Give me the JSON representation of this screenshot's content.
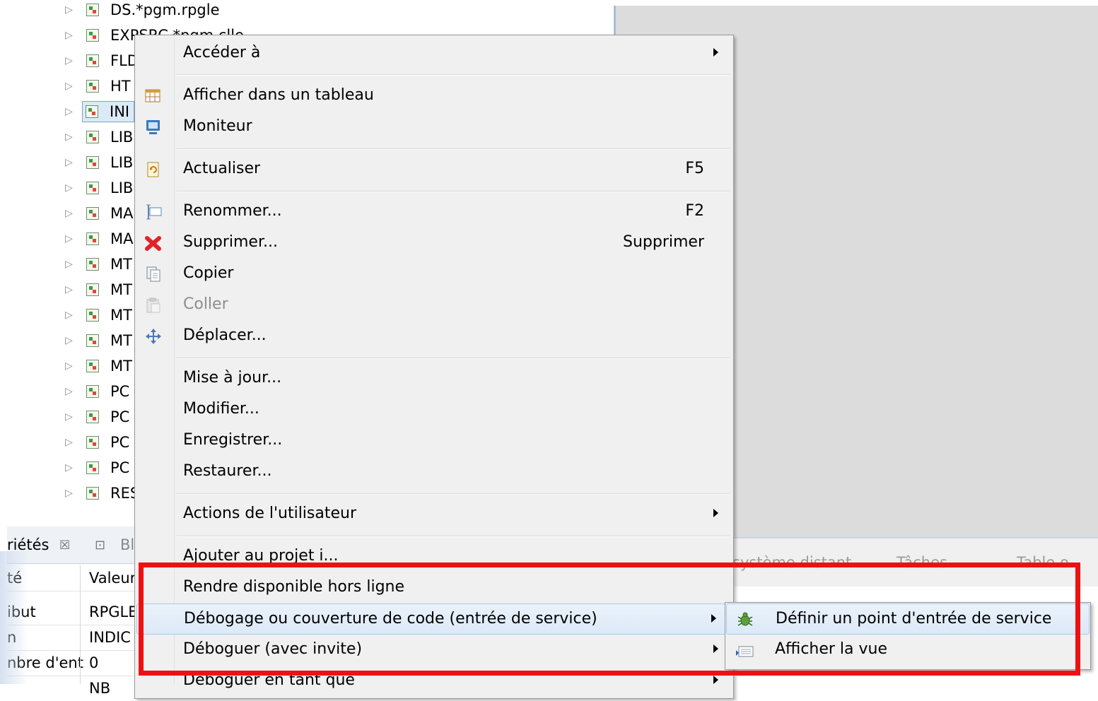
{
  "tree": {
    "rows": [
      {
        "label": "DS.*pgm.rpgle"
      },
      {
        "label": "EXPSRC.*pgm.clle"
      },
      {
        "label": "FLD"
      },
      {
        "label": "HT"
      },
      {
        "label": "INI"
      },
      {
        "label": "LIB"
      },
      {
        "label": "LIB"
      },
      {
        "label": "LIB"
      },
      {
        "label": "MA"
      },
      {
        "label": "MA"
      },
      {
        "label": "MT"
      },
      {
        "label": "MT"
      },
      {
        "label": "MT"
      },
      {
        "label": "MT"
      },
      {
        "label": "MT"
      },
      {
        "label": "PC"
      },
      {
        "label": "PC"
      },
      {
        "label": "PC"
      },
      {
        "label": "PC"
      },
      {
        "label": "RES"
      }
    ]
  },
  "properties": {
    "tab_label": "riétés",
    "tab_close": "☒",
    "tab2_label": "Bl",
    "col_property": "té",
    "col_value": "Valeur",
    "rows": [
      {
        "prop": "ibut",
        "value": "RPGLE"
      },
      {
        "prop": "n",
        "value": "INDIC"
      },
      {
        "prop": "nbre d'ent",
        "value": "0"
      },
      {
        "prop": "",
        "value": "NB"
      }
    ]
  },
  "bottom_strip": {
    "tab_remote": "système distant",
    "tab_tasks": "Tâches",
    "tab_table": "Table o"
  },
  "context_menu": {
    "items": [
      {
        "label": "Accéder à",
        "shortcut": "",
        "submenu": true,
        "icon": ""
      },
      {
        "label": "Afficher dans un tableau",
        "shortcut": "",
        "submenu": false,
        "icon": "table-icon"
      },
      {
        "label": "Moniteur",
        "shortcut": "",
        "submenu": false,
        "icon": "monitor-icon"
      },
      {
        "label": "Actualiser",
        "shortcut": "F5",
        "submenu": false,
        "icon": "refresh-icon"
      },
      {
        "label": "Renommer...",
        "shortcut": "F2",
        "submenu": false,
        "icon": "rename-icon"
      },
      {
        "label": "Supprimer...",
        "shortcut": "Supprimer",
        "submenu": false,
        "icon": "delete-icon"
      },
      {
        "label": "Copier",
        "shortcut": "",
        "submenu": false,
        "icon": "copy-icon"
      },
      {
        "label": "Coller",
        "shortcut": "",
        "submenu": false,
        "icon": "paste-icon",
        "disabled": true
      },
      {
        "label": "Déplacer...",
        "shortcut": "",
        "submenu": false,
        "icon": "move-icon"
      },
      {
        "label": "Mise à jour...",
        "shortcut": "",
        "submenu": false,
        "icon": ""
      },
      {
        "label": "Modifier...",
        "shortcut": "",
        "submenu": false,
        "icon": ""
      },
      {
        "label": "Enregistrer...",
        "shortcut": "",
        "submenu": false,
        "icon": ""
      },
      {
        "label": "Restaurer...",
        "shortcut": "",
        "submenu": false,
        "icon": ""
      },
      {
        "label": "Actions de l'utilisateur",
        "shortcut": "",
        "submenu": true,
        "icon": ""
      },
      {
        "label": "Ajouter au projet i...",
        "shortcut": "",
        "submenu": false,
        "icon": ""
      },
      {
        "label": "Rendre disponible hors ligne",
        "shortcut": "",
        "submenu": false,
        "icon": ""
      },
      {
        "label": "Débogage ou couverture de code (entrée de service)",
        "shortcut": "",
        "submenu": true,
        "icon": "",
        "highlighted": true
      },
      {
        "label": "Déboguer (avec invite)",
        "shortcut": "",
        "submenu": true,
        "icon": ""
      },
      {
        "label": "Déboguer en tant que",
        "shortcut": "",
        "submenu": true,
        "icon": ""
      }
    ]
  },
  "submenu": {
    "items": [
      {
        "label": "Définir un point d'entrée de service",
        "icon": "bug-icon",
        "highlighted": true
      },
      {
        "label": "Afficher la vue",
        "icon": "view-icon"
      }
    ]
  },
  "colors": {
    "highlight_border": "#ee1111",
    "menu_bg": "#f0f0f0",
    "selection_bg": "#dce9f7"
  }
}
